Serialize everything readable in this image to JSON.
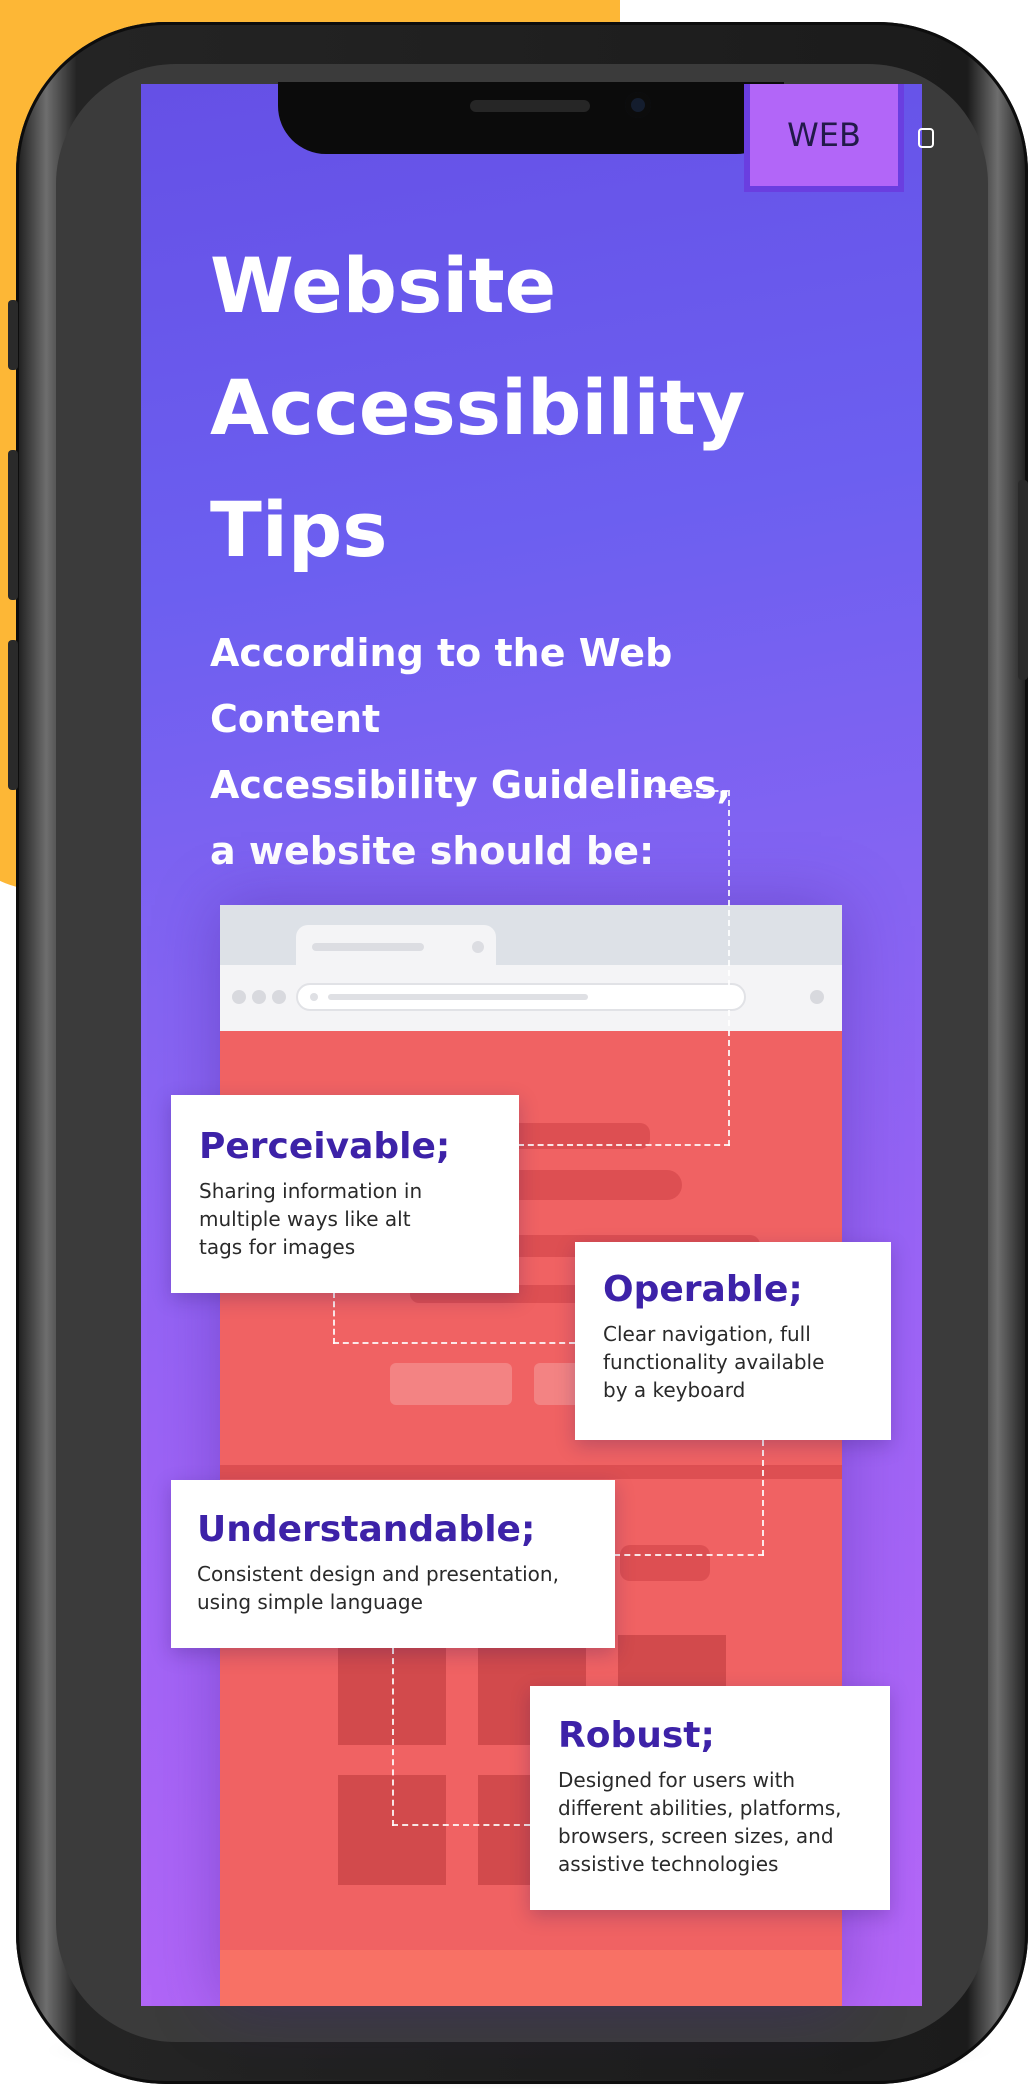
{
  "tag": "WEB",
  "title_lines": [
    "Website",
    "Accessibility",
    "Tips"
  ],
  "subtitle_lines": [
    "According to the Web Content",
    "Accessibility Guidelines,",
    "a website should be:"
  ],
  "principles": [
    {
      "title": "Perceivable;",
      "description": [
        "Sharing information in",
        "multiple ways like alt",
        "tags for images"
      ]
    },
    {
      "title": "Operable;",
      "description": [
        "Clear navigation, full",
        "functionality available",
        "by a keyboard"
      ]
    },
    {
      "title": "Understandable;",
      "description": [
        "Consistent design and presentation,",
        "using simple language"
      ]
    },
    {
      "title": "Robust;",
      "description": [
        "Designed for users with",
        "different abilities, platforms,",
        "browsers, screen sizes, and",
        "assistive technologies"
      ]
    }
  ],
  "colors": {
    "background_blob": "#fdb736",
    "screen_gradient_start": "#6550e6",
    "screen_gradient_end": "#b566f7",
    "card_title": "#3d22a8",
    "browser_body": "#f06263"
  },
  "icons": [
    "battery-icon",
    "camera-icon",
    "speaker-icon"
  ]
}
